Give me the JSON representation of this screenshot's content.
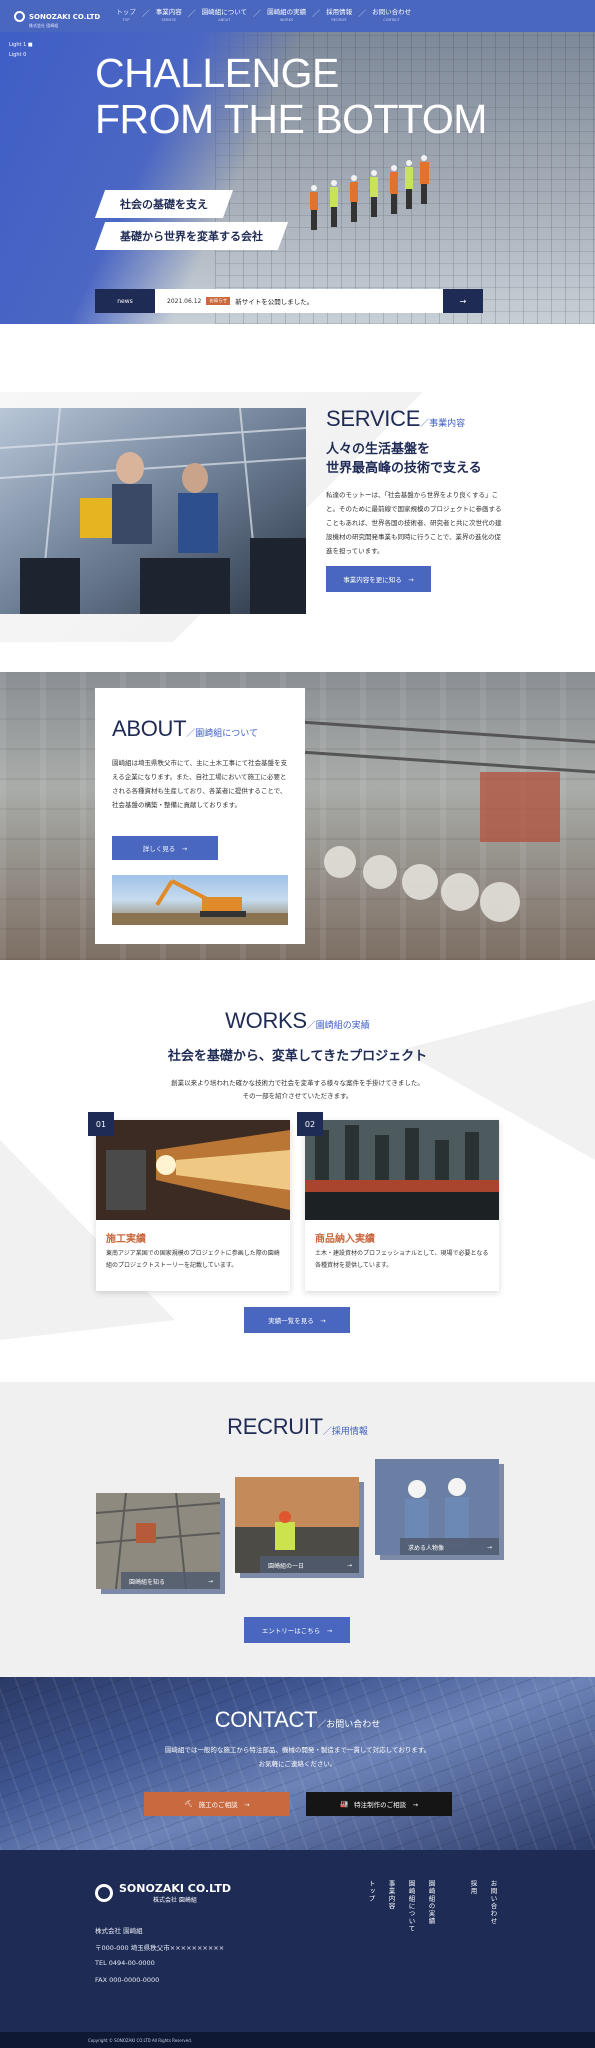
{
  "header": {
    "logo": "SONOZAKI CO.LTD",
    "logo_sub": "株式会社 園崎組",
    "nav": [
      {
        "label": "トップ",
        "sub": "TOP"
      },
      {
        "label": "事業内容",
        "sub": "SERVICE"
      },
      {
        "label": "園崎組について",
        "sub": "ABOUT"
      },
      {
        "label": "園崎組の実績",
        "sub": "WORKS"
      },
      {
        "label": "採用情報",
        "sub": "RECRUIT"
      },
      {
        "label": "お問い合わせ",
        "sub": "CONTACT"
      }
    ]
  },
  "hero": {
    "light1": "Light 1 ■",
    "light2": "Light 0",
    "title_line1": "CHALLENGE",
    "title_line2": "FROM THE BOTTOM",
    "ribbon1": "社会の基礎を支え",
    "ribbon2": "基礎から世界を変革する会社",
    "news_label": "news",
    "news_date": "2021.06.12",
    "news_badge": "お知らせ",
    "news_text": "新サイトを公開しました。",
    "news_arrow": "→"
  },
  "service": {
    "heading": "SERVICE",
    "heading_sub": "／事業内容",
    "subtitle_line1": "人々の生活基盤を",
    "subtitle_line2": "世界最高峰の技術で支える",
    "body": "私達のモットーは、「社会基盤から世界をより良くする」こと。そのために最前線で国家規模のプロジェクトに参画することもあれば、世界各国の技術者、研究者と共に次世代の建設機材の研究開発事業も同時に行うことで、業界の進化の促進を担っています。",
    "button": "事業内容を更に知る　→"
  },
  "about": {
    "heading": "ABOUT",
    "heading_sub": "／園崎組について",
    "body": "園崎組は埼玉県秩父市にて、主に土木工事にて社会基盤を支える企業になります。また、自社工場において施工に必要とされる各種資材も生産しており、各業者に提供することで、社会基盤の構築・整備に貢献しております。",
    "button": "詳しく見る　→"
  },
  "works": {
    "heading": "WORKS",
    "heading_sub": "／園崎組の実績",
    "subtitle": "社会を基礎から、変革してきたプロジェクト",
    "intro_line1": "創業以来より培われた確かな技術力で社会を変革する様々な案件を手掛けてきました。",
    "intro_line2": "その一部を紹介させていただきます。",
    "cards": [
      {
        "num": "01",
        "title": "施工実績",
        "desc": "東南アジア某国での国家規模のプロジェクトに参画した際の園崎組のプロジェクトストーリーを記載しています。"
      },
      {
        "num": "02",
        "title": "商品納入実績",
        "desc": "土木・建設資材のプロフェッショナルとして、現場で必要となる各種資材を提供しています。"
      }
    ],
    "button": "実績一覧を見る　→"
  },
  "recruit": {
    "heading": "RECRUIT",
    "heading_sub": "／採用情報",
    "tiles": [
      {
        "label": "園崎組を知る",
        "arrow": "→"
      },
      {
        "label": "園崎組の一日",
        "arrow": "→"
      },
      {
        "label": "求める人物像",
        "arrow": "→"
      }
    ],
    "button": "エントリーはこちら　→"
  },
  "contact": {
    "heading": "CONTACT",
    "heading_sub": "／お問い合わせ",
    "line1": "園崎組では一般的な施工から特注部品、機械の開発・製造まで一貫して対応しております。",
    "line2": "お気軽にご連絡ください。",
    "button1": "施工のご相談　→",
    "button2": "特注制作のご相談　→",
    "accent1": "#c8693f",
    "accent2": "#1a1a1a"
  },
  "footer": {
    "logo": "SONOZAKI CO.LTD",
    "logo_sub": "株式会社 園崎組",
    "company": "株式会社 園崎組",
    "address": "〒000-000 埼玉県秩父市××××××××××",
    "tel": "TEL 0494-00-0000",
    "fax": "FAX 000-0000-0000",
    "links": [
      "トップ",
      "事業内容",
      "園崎組について",
      "園崎組の実績",
      "採用",
      "お問い合わせ"
    ],
    "copyright": "Copyright © SONOZAKI CO.LTD All Rights Reserved."
  },
  "colors": {
    "brand": "#4a67bf",
    "navy": "#1d2b55",
    "accent": "#c8693f"
  }
}
